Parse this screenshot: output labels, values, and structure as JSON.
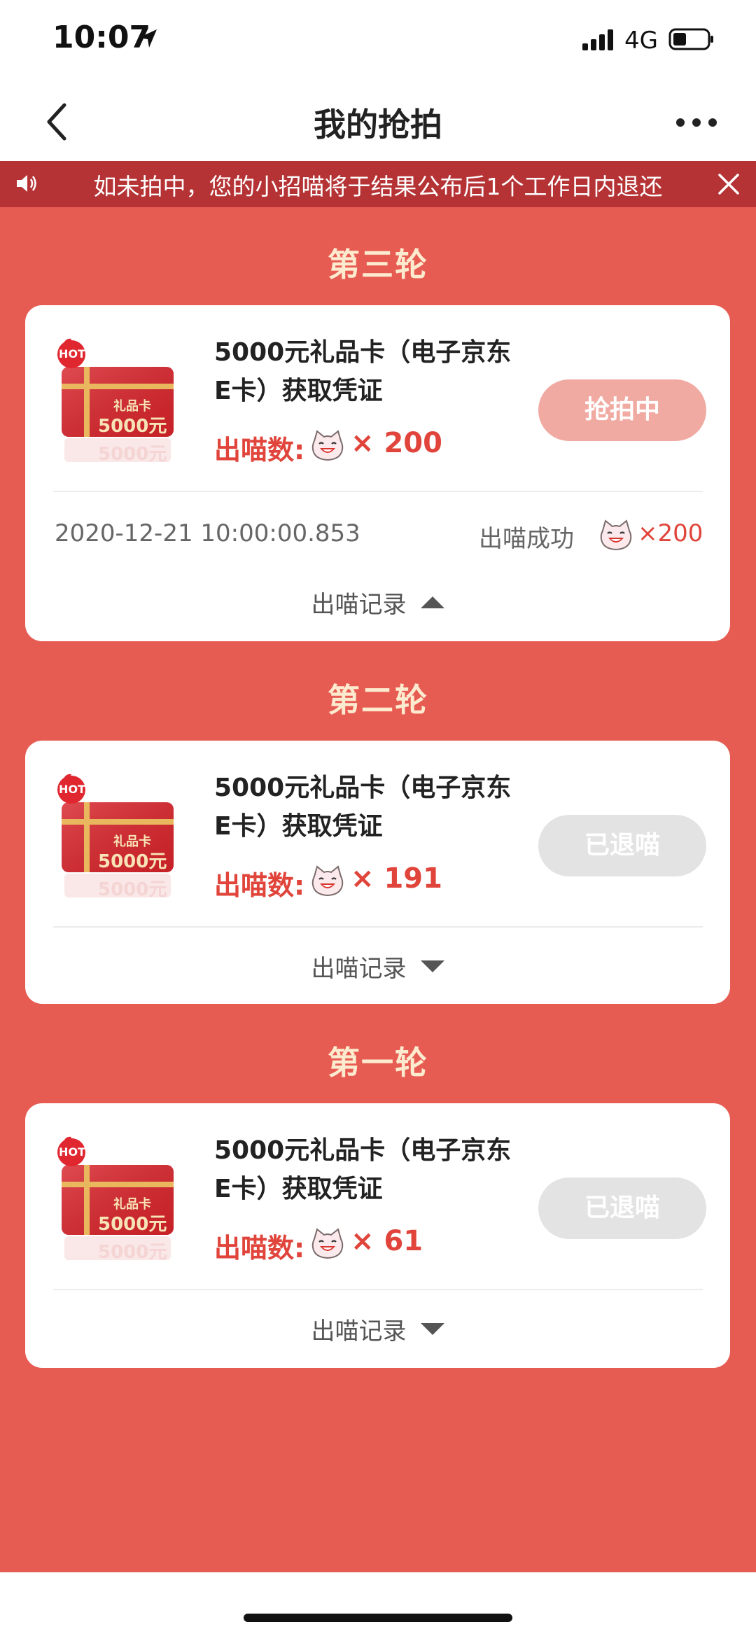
{
  "status_bar": {
    "time": "10:07",
    "network": "4G"
  },
  "nav": {
    "title": "我的抢拍"
  },
  "notice": {
    "text": "如未拍中，您的小招喵将于结果公布后1个工作日内退还"
  },
  "thumbnail": {
    "badge": "HOT",
    "card_label": "礼品卡",
    "card_value": "5000元",
    "card_value_reflection": "5000元"
  },
  "rounds": [
    {
      "title": "第三轮",
      "item_line1": "5000元礼品卡（电子京东",
      "item_line2": "E卡）获取凭证",
      "bid_label": "出喵数:",
      "bid_count": "× 200",
      "status": "抢拍中",
      "record_time": "2020-12-21 10:00:00.853",
      "record_status": "出喵成功",
      "record_amount": "×200",
      "record_link": "出喵记录"
    },
    {
      "title": "第二轮",
      "item_line1": "5000元礼品卡（电子京东",
      "item_line2": "E卡）获取凭证",
      "bid_label": "出喵数:",
      "bid_count": "× 191",
      "status": "已退喵",
      "record_link": "出喵记录"
    },
    {
      "title": "第一轮",
      "item_line1": "5000元礼品卡（电子京东",
      "item_line2": "E卡）获取凭证",
      "bid_label": "出喵数:",
      "bid_count": "× 61",
      "status": "已退喵",
      "record_link": "出喵记录"
    }
  ],
  "colors": {
    "brand_red": "#e75c52",
    "notice_bg": "#b53335",
    "accent_text": "#e0443a",
    "round_title": "#fdebd0"
  }
}
